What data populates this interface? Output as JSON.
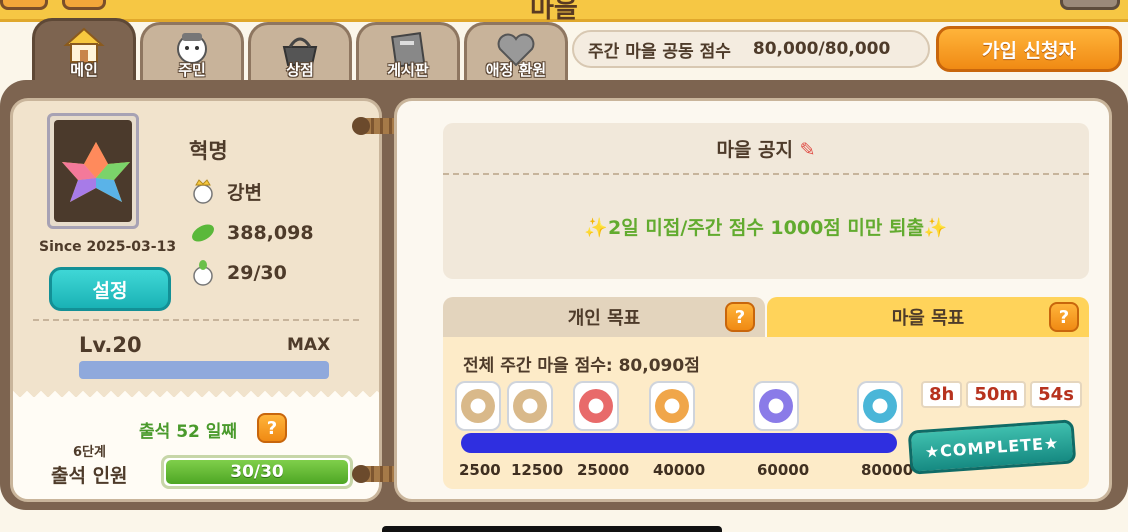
{
  "top": {
    "title": "마을"
  },
  "tabs": [
    {
      "label": "메인",
      "icon": "house-icon"
    },
    {
      "label": "주민",
      "icon": "villager-icon"
    },
    {
      "label": "상점",
      "icon": "basket-icon"
    },
    {
      "label": "게시판",
      "icon": "board-icon"
    },
    {
      "label": "애정 환원",
      "icon": "heart-icon"
    }
  ],
  "weekly_score": {
    "label": "주간 마을 공동 점수",
    "value": "80,000/80,000"
  },
  "join_button": "가입 신청자",
  "village": {
    "since": "Since 2025-03-13",
    "settings_label": "설정",
    "name": "혁명",
    "leader": "강변",
    "points": "388,098",
    "members": "29/30",
    "level": "Lv.20",
    "level_state": "MAX",
    "level_progress": 1.0,
    "attendance": "출석 52 일째",
    "stage": "6단계",
    "attend_label": "출석 인원",
    "attend_value": "30/30",
    "attend_progress": 1.0
  },
  "notice": {
    "title": "마을 공지",
    "body": "✨2일 미접/주간 점수 1000점 미만 퇴출✨"
  },
  "goals": {
    "personal_tab": "개인 목표",
    "village_tab": "마을 목표",
    "total": "전체 주간 마을 점수: 80,090점",
    "milestones": [
      {
        "value": "2500",
        "color": "#d9b98a"
      },
      {
        "value": "12500",
        "color": "#d9b98a"
      },
      {
        "value": "25000",
        "color": "#e86a6a"
      },
      {
        "value": "40000",
        "color": "#f0a64a"
      },
      {
        "value": "60000",
        "color": "#8a7be8"
      },
      {
        "value": "80000",
        "color": "#4ab6d8"
      }
    ],
    "timer": {
      "h": "8h",
      "m": "50m",
      "s": "54s"
    },
    "complete_label": "★COMPLETE★"
  }
}
